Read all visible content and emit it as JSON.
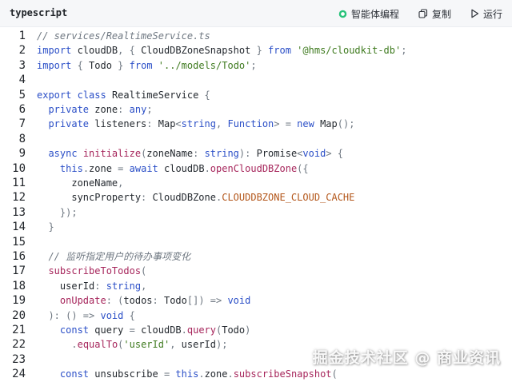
{
  "header": {
    "language": "typescript",
    "actions": [
      {
        "label": "智能体编程",
        "icon": "ai-agent-icon"
      },
      {
        "label": "复制",
        "icon": "copy-icon"
      },
      {
        "label": "运行",
        "icon": "play-icon"
      }
    ]
  },
  "colors": {
    "keyword": "#2b4fc7",
    "function": "#a6255b",
    "string": "#3e7a1e",
    "comment": "#6e7781",
    "constant": "#b3561a",
    "ai_accent": "#27c27a"
  },
  "code": {
    "lines": [
      {
        "num": "1",
        "tokens": [
          {
            "t": "// services/RealtimeService.ts",
            "c": "com"
          }
        ]
      },
      {
        "num": "2",
        "tokens": [
          {
            "t": "import",
            "c": "kw"
          },
          {
            "t": " cloudDB",
            "c": "plain"
          },
          {
            "t": ", { ",
            "c": "pun"
          },
          {
            "t": "CloudDBZoneSnapshot",
            "c": "plain"
          },
          {
            "t": " } ",
            "c": "pun"
          },
          {
            "t": "from",
            "c": "kw"
          },
          {
            "t": " ",
            "c": "plain"
          },
          {
            "t": "'@hms/cloudkit-db'",
            "c": "str"
          },
          {
            "t": ";",
            "c": "pun"
          }
        ]
      },
      {
        "num": "3",
        "tokens": [
          {
            "t": "import",
            "c": "kw"
          },
          {
            "t": " { ",
            "c": "pun"
          },
          {
            "t": "Todo",
            "c": "plain"
          },
          {
            "t": " } ",
            "c": "pun"
          },
          {
            "t": "from",
            "c": "kw"
          },
          {
            "t": " ",
            "c": "plain"
          },
          {
            "t": "'../models/Todo'",
            "c": "str"
          },
          {
            "t": ";",
            "c": "pun"
          }
        ]
      },
      {
        "num": "4",
        "tokens": []
      },
      {
        "num": "5",
        "tokens": [
          {
            "t": "export",
            "c": "kw"
          },
          {
            "t": " ",
            "c": "plain"
          },
          {
            "t": "class",
            "c": "kw"
          },
          {
            "t": " RealtimeService ",
            "c": "plain"
          },
          {
            "t": "{",
            "c": "pun"
          }
        ]
      },
      {
        "num": "6",
        "tokens": [
          {
            "t": "  ",
            "c": "plain"
          },
          {
            "t": "private",
            "c": "kw"
          },
          {
            "t": " zone",
            "c": "plain"
          },
          {
            "t": ":",
            "c": "pun"
          },
          {
            "t": " ",
            "c": "plain"
          },
          {
            "t": "any",
            "c": "kw"
          },
          {
            "t": ";",
            "c": "pun"
          }
        ]
      },
      {
        "num": "7",
        "tokens": [
          {
            "t": "  ",
            "c": "plain"
          },
          {
            "t": "private",
            "c": "kw"
          },
          {
            "t": " listeners",
            "c": "plain"
          },
          {
            "t": ":",
            "c": "pun"
          },
          {
            "t": " Map",
            "c": "plain"
          },
          {
            "t": "<",
            "c": "pun"
          },
          {
            "t": "string",
            "c": "kw"
          },
          {
            "t": ", ",
            "c": "pun"
          },
          {
            "t": "Function",
            "c": "kw"
          },
          {
            "t": "> = ",
            "c": "pun"
          },
          {
            "t": "new",
            "c": "kw"
          },
          {
            "t": " Map",
            "c": "plain"
          },
          {
            "t": "();",
            "c": "pun"
          }
        ]
      },
      {
        "num": "8",
        "tokens": []
      },
      {
        "num": "9",
        "tokens": [
          {
            "t": "  ",
            "c": "plain"
          },
          {
            "t": "async",
            "c": "kw"
          },
          {
            "t": " ",
            "c": "plain"
          },
          {
            "t": "initialize",
            "c": "fn"
          },
          {
            "t": "(",
            "c": "pun"
          },
          {
            "t": "zoneName",
            "c": "plain"
          },
          {
            "t": ":",
            "c": "pun"
          },
          {
            "t": " ",
            "c": "plain"
          },
          {
            "t": "string",
            "c": "kw"
          },
          {
            "t": "):",
            "c": "pun"
          },
          {
            "t": " Promise",
            "c": "plain"
          },
          {
            "t": "<",
            "c": "pun"
          },
          {
            "t": "void",
            "c": "kw"
          },
          {
            "t": "> {",
            "c": "pun"
          }
        ]
      },
      {
        "num": "10",
        "tokens": [
          {
            "t": "    ",
            "c": "plain"
          },
          {
            "t": "this",
            "c": "kw"
          },
          {
            "t": ".",
            "c": "pun"
          },
          {
            "t": "zone",
            "c": "plain"
          },
          {
            "t": " = ",
            "c": "pun"
          },
          {
            "t": "await",
            "c": "kw"
          },
          {
            "t": " cloudDB",
            "c": "plain"
          },
          {
            "t": ".",
            "c": "pun"
          },
          {
            "t": "openCloudDBZone",
            "c": "fn"
          },
          {
            "t": "({",
            "c": "pun"
          }
        ]
      },
      {
        "num": "11",
        "tokens": [
          {
            "t": "      zoneName",
            "c": "plain"
          },
          {
            "t": ",",
            "c": "pun"
          }
        ]
      },
      {
        "num": "12",
        "tokens": [
          {
            "t": "      syncProperty",
            "c": "plain"
          },
          {
            "t": ":",
            "c": "pun"
          },
          {
            "t": " CloudDBZone",
            "c": "plain"
          },
          {
            "t": ".",
            "c": "pun"
          },
          {
            "t": "CLOUDDBZONE_CLOUD_CACHE",
            "c": "const"
          }
        ]
      },
      {
        "num": "13",
        "tokens": [
          {
            "t": "    });",
            "c": "pun"
          }
        ]
      },
      {
        "num": "14",
        "tokens": [
          {
            "t": "  }",
            "c": "pun"
          }
        ]
      },
      {
        "num": "15",
        "tokens": []
      },
      {
        "num": "16",
        "tokens": [
          {
            "t": "  ",
            "c": "plain"
          },
          {
            "t": "// 监听指定用户的待办事项变化",
            "c": "com"
          }
        ]
      },
      {
        "num": "17",
        "tokens": [
          {
            "t": "  ",
            "c": "plain"
          },
          {
            "t": "subscribeToTodos",
            "c": "fn"
          },
          {
            "t": "(",
            "c": "pun"
          }
        ]
      },
      {
        "num": "18",
        "tokens": [
          {
            "t": "    userId",
            "c": "plain"
          },
          {
            "t": ":",
            "c": "pun"
          },
          {
            "t": " ",
            "c": "plain"
          },
          {
            "t": "string",
            "c": "kw"
          },
          {
            "t": ",",
            "c": "pun"
          }
        ]
      },
      {
        "num": "19",
        "tokens": [
          {
            "t": "    ",
            "c": "plain"
          },
          {
            "t": "onUpdate",
            "c": "fn"
          },
          {
            "t": ":",
            "c": "pun"
          },
          {
            "t": " (",
            "c": "pun"
          },
          {
            "t": "todos",
            "c": "plain"
          },
          {
            "t": ":",
            "c": "pun"
          },
          {
            "t": " Todo",
            "c": "plain"
          },
          {
            "t": "[]) => ",
            "c": "pun"
          },
          {
            "t": "void",
            "c": "kw"
          }
        ]
      },
      {
        "num": "20",
        "tokens": [
          {
            "t": "  ):",
            "c": "pun"
          },
          {
            "t": " () => ",
            "c": "pun"
          },
          {
            "t": "void",
            "c": "kw"
          },
          {
            "t": " {",
            "c": "pun"
          }
        ]
      },
      {
        "num": "21",
        "tokens": [
          {
            "t": "    ",
            "c": "plain"
          },
          {
            "t": "const",
            "c": "kw"
          },
          {
            "t": " query ",
            "c": "plain"
          },
          {
            "t": "=",
            "c": "pun"
          },
          {
            "t": " cloudDB",
            "c": "plain"
          },
          {
            "t": ".",
            "c": "pun"
          },
          {
            "t": "query",
            "c": "fn"
          },
          {
            "t": "(",
            "c": "pun"
          },
          {
            "t": "Todo",
            "c": "plain"
          },
          {
            "t": ")",
            "c": "pun"
          }
        ]
      },
      {
        "num": "22",
        "tokens": [
          {
            "t": "      ",
            "c": "plain"
          },
          {
            "t": ".",
            "c": "pun"
          },
          {
            "t": "equalTo",
            "c": "fn"
          },
          {
            "t": "(",
            "c": "pun"
          },
          {
            "t": "'userId'",
            "c": "str"
          },
          {
            "t": ", ",
            "c": "pun"
          },
          {
            "t": "userId",
            "c": "plain"
          },
          {
            "t": ");",
            "c": "pun"
          }
        ]
      },
      {
        "num": "23",
        "tokens": []
      },
      {
        "num": "24",
        "tokens": [
          {
            "t": "    ",
            "c": "plain"
          },
          {
            "t": "const",
            "c": "kw"
          },
          {
            "t": " unsubscribe ",
            "c": "plain"
          },
          {
            "t": "=",
            "c": "pun"
          },
          {
            "t": " ",
            "c": "plain"
          },
          {
            "t": "this",
            "c": "kw"
          },
          {
            "t": ".",
            "c": "pun"
          },
          {
            "t": "zone",
            "c": "plain"
          },
          {
            "t": ".",
            "c": "pun"
          },
          {
            "t": "subscribeSnapshot",
            "c": "fn"
          },
          {
            "t": "(",
            "c": "pun"
          }
        ]
      }
    ]
  },
  "watermark": "掘金技术社区 @ 商业资讯"
}
